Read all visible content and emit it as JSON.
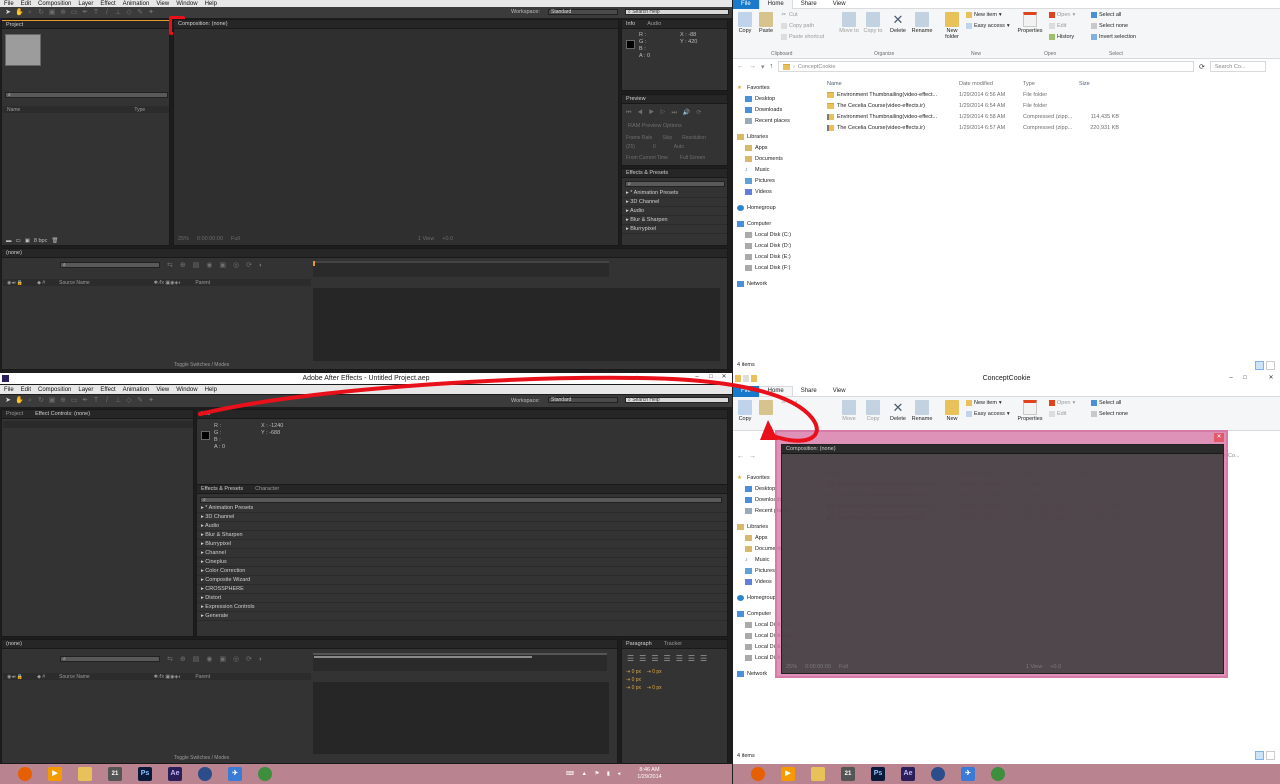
{
  "ae": {
    "menu": [
      "File",
      "Edit",
      "Composition",
      "Layer",
      "Effect",
      "Animation",
      "View",
      "Window",
      "Help"
    ],
    "workspace_label": "Workspace:",
    "workspace_value": "Standard",
    "search_help": "Search Help",
    "title": "Adobe After Effects - Untitled Project.aep",
    "top": {
      "project_tab": "Project",
      "composition_tab": "Composition: (none)",
      "info_tab": "Info",
      "audio_tab": "Audio",
      "info_x": "X : -88",
      "info_y": "Y : 420",
      "rgba": [
        "R :",
        "G :",
        "B :",
        "A : 0"
      ],
      "project_cols": [
        "Name",
        "Type"
      ],
      "bpc": "8 bpc",
      "zoom": "25%",
      "time": "0:00:00:00",
      "resolution": "Full",
      "view": "1 View",
      "exposure": "+0.0",
      "preview_tab": "Preview",
      "ram_preview": "RAM Preview Options",
      "frame_rate_label": "Frame Rate",
      "skip_label": "Skip",
      "resolution_label": "Resolution",
      "frame_rate_value": "(25)",
      "skip_value": "0",
      "resolution_value": "Auto",
      "from_current": "From Current Time",
      "full_screen": "Full Screen",
      "effects_tab": "Effects & Presets",
      "effects": [
        "* Animation Presets",
        "3D Channel",
        "Audio",
        "Blur & Sharpen",
        "Blurrypixel"
      ],
      "timeline_tab": "(none)",
      "layer_cols": [
        "Source Name",
        "Parent"
      ],
      "toggle": "Toggle Switches / Modes"
    },
    "bottom": {
      "project_tab": "Project",
      "effect_controls_tab": "Effect Controls: (none)",
      "info_tab": "Info",
      "rgba": [
        "R :",
        "G :",
        "B :",
        "A : 0"
      ],
      "info_x": "X : -1240",
      "info_y": "Y : -688",
      "effects_tab": "Effects & Presets",
      "character_tab": "Character",
      "effects": [
        "* Animation Presets",
        "3D Channel",
        "Audio",
        "Blur & Sharpen",
        "Blurrypixel",
        "Channel",
        "Cineplus",
        "Color Correction",
        "Composite Wizard",
        "CROSSPHERE",
        "Distort",
        "Expression Controls",
        "Generate"
      ],
      "timeline_tab": "(none)",
      "layer_cols": [
        "Source Name",
        "Parent"
      ],
      "toggle": "Toggle Switches / Modes",
      "paragraph_tab": "Paragraph",
      "tracker_tab": "Tracker",
      "px_values": [
        "0 px",
        "0 px",
        "0 px",
        "0 px",
        "0 px"
      ]
    },
    "floating": {
      "tab": "Composition: (none)",
      "zoom": "25%",
      "time": "0:00:00:00",
      "resolution": "Full",
      "view": "1 View",
      "exposure": "+0.0"
    }
  },
  "explorer": {
    "title": "ConceptCookie",
    "tabs": {
      "file": "File",
      "home": "Home",
      "share": "Share",
      "view": "View"
    },
    "ribbon": {
      "copy": "Copy",
      "paste": "Paste",
      "cut": "Cut",
      "copy_path": "Copy path",
      "paste_shortcut": "Paste shortcut",
      "move_to": "Move to",
      "copy_to": "Copy to",
      "delete": "Delete",
      "rename": "Rename",
      "new_folder": "New folder",
      "new_item": "New item",
      "easy_access": "Easy access",
      "properties": "Properties",
      "open": "Open",
      "edit": "Edit",
      "history": "History",
      "select_all": "Select all",
      "select_none": "Select none",
      "invert_selection": "Invert selection",
      "groups": [
        "Clipboard",
        "Organize",
        "New",
        "Open",
        "Select"
      ]
    },
    "path": "ConceptCookie",
    "search_placeholder": "Search Co...",
    "nav": {
      "favorites": "Favorites",
      "favorites_items": [
        "Desktop",
        "Downloads",
        "Recent places"
      ],
      "libraries": "Libraries",
      "libraries_items": [
        "Apps",
        "Documents",
        "Music",
        "Pictures",
        "Videos"
      ],
      "homegroup": "Homegroup",
      "computer": "Computer",
      "computer_items": [
        "Local Disk (C:)",
        "Local Disk (D:)",
        "Local Disk (E:)",
        "Local Disk (F:)"
      ],
      "network": "Network"
    },
    "columns": [
      "Name",
      "Date modified",
      "Type",
      "Size"
    ],
    "files": [
      {
        "name": "Environment Thumbnailing(video-effect...",
        "date": "1/29/2014 6:56 AM",
        "type": "File folder",
        "size": ""
      },
      {
        "name": "The Cecelia Course(video-effects.ir)",
        "date": "1/29/2014 6:54 AM",
        "type": "File folder",
        "size": ""
      },
      {
        "name": "Environment Thumbnailing(video-effect...",
        "date": "1/29/2014 6:58 AM",
        "type": "Compressed (zipp...",
        "size": "114,435 KB"
      },
      {
        "name": "The Cecelia Course(video-effects.ir)",
        "date": "1/29/2014 6:57 AM",
        "type": "Compressed (zipp...",
        "size": "220,931 KB"
      }
    ],
    "status": "4 items"
  },
  "taskbar": {
    "time": "8:46 AM",
    "date": "1/29/2014",
    "apps": [
      "Firefox",
      "Media Player",
      "File Explorer",
      "Calendar",
      "Photoshop",
      "After Effects",
      "Cinema 4D",
      "Remote",
      "Globe"
    ]
  },
  "colors": {
    "annotation_red": "#e8101a",
    "pink_overlay": "#d77aa8",
    "explorer_file_tab": "#1979ca",
    "ae_orange": "#e59b2d"
  }
}
